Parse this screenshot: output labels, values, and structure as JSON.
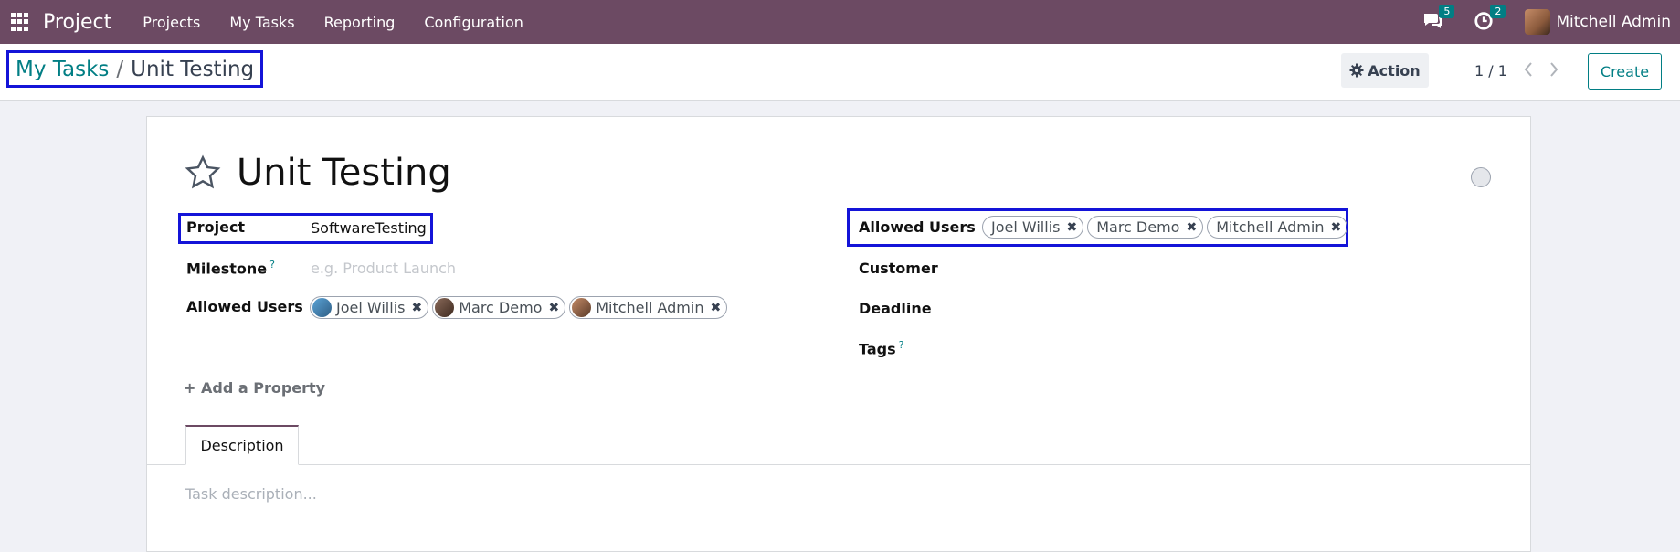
{
  "navbar": {
    "app_title": "Project",
    "menu": [
      "Projects",
      "My Tasks",
      "Reporting",
      "Configuration"
    ],
    "messages_count": "5",
    "activities_count": "2",
    "user_name": "Mitchell Admin"
  },
  "breadcrumb": {
    "parent": "My Tasks",
    "separator": "/",
    "current": "Unit Testing"
  },
  "toolbar": {
    "action_label": "Action",
    "pager": "1 / 1",
    "create_label": "Create"
  },
  "form": {
    "title": "Unit Testing",
    "project_label": "Project",
    "project_value": "SoftwareTesting",
    "milestone_label": "Milestone",
    "milestone_placeholder": "e.g. Product Launch",
    "help_mark": "?",
    "allowed_users_label": "Allowed Users",
    "allowed_users": [
      "Joel Willis",
      "Marc Demo",
      "Mitchell Admin"
    ],
    "customer_label": "Customer",
    "deadline_label": "Deadline",
    "tags_label": "Tags",
    "add_property": "Add a Property",
    "tab_description": "Description",
    "description_placeholder": "Task description..."
  },
  "colors": {
    "navbar": "#6c4a63",
    "accent": "#017e84",
    "highlight": "#1414d8"
  }
}
